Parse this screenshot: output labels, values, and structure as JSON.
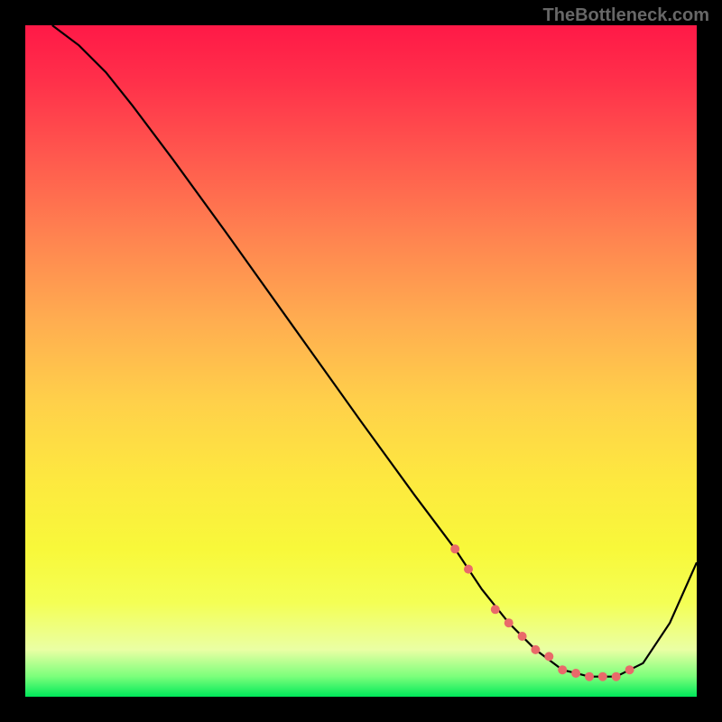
{
  "watermark": "TheBottleneck.com",
  "chart_data": {
    "type": "line",
    "title": "",
    "xlabel": "",
    "ylabel": "",
    "xlim": [
      0,
      100
    ],
    "ylim": [
      0,
      100
    ],
    "series": [
      {
        "name": "bottleneck-curve",
        "x": [
          4,
          8,
          12,
          16,
          22,
          30,
          40,
          50,
          58,
          64,
          68,
          72,
          76,
          80,
          84,
          88,
          92,
          96,
          100
        ],
        "y": [
          100,
          97,
          93,
          88,
          80,
          69,
          55,
          41,
          30,
          22,
          16,
          11,
          7,
          4,
          3,
          3,
          5,
          11,
          20
        ]
      }
    ],
    "markers": {
      "name": "highlight-dots",
      "color": "#e96a6a",
      "x": [
        64,
        66,
        70,
        72,
        74,
        76,
        78,
        80,
        82,
        84,
        86,
        88,
        90
      ],
      "y": [
        22,
        19,
        13,
        11,
        9,
        7,
        6,
        4,
        3.5,
        3,
        3,
        3,
        4
      ]
    }
  }
}
